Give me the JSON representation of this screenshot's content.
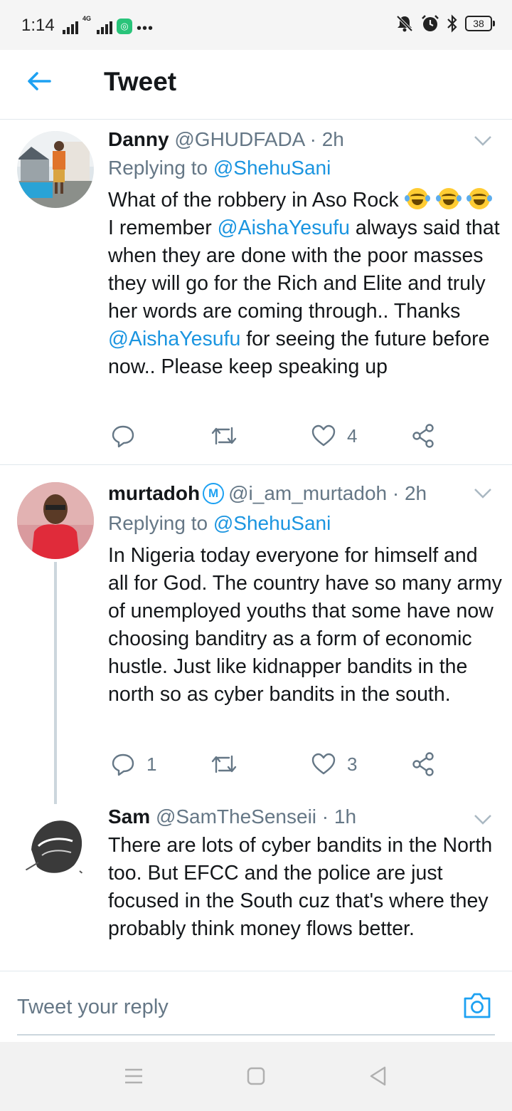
{
  "status_bar": {
    "time": "1:14",
    "network": "4G",
    "more": "•••",
    "battery": "38",
    "icons": [
      "signal-icon",
      "signal-4g-icon",
      "app-notification-icon",
      "mute-icon",
      "alarm-icon",
      "bluetooth-icon",
      "battery-icon"
    ]
  },
  "header": {
    "title": "Tweet",
    "back_icon": "arrow-left-icon"
  },
  "tweets": [
    {
      "name": "Danny",
      "handle": "@GHUDFADA",
      "time": "· 2h",
      "replying_label": "Replying to",
      "replying_to": "@ShehuSani",
      "body": {
        "p1": "What of the robbery in Aso Rock",
        "p2": " I remember ",
        "mention1": "@AishaYesufu",
        "p3": " always said that when they are done with the poor masses they will go for the Rich and Elite and truly her words are coming through.. Thanks ",
        "mention2": "@AishaYesufu",
        "p4": " for seeing the future before now.. Please keep speaking up"
      },
      "reply_count": "",
      "retweet_count": "",
      "like_count": "4"
    },
    {
      "name": "murtadoh",
      "verified_glyph": "M",
      "handle": "@i_am_murtadoh",
      "time": "· 2h",
      "replying_label": "Replying to",
      "replying_to": "@ShehuSani",
      "body": "In Nigeria today everyone for himself and all for God. The country have so many army of unemployed youths that some have now choosing banditry as a form of economic hustle. Just like kidnapper bandits in the north so as cyber bandits in the south.",
      "reply_count": "1",
      "retweet_count": "",
      "like_count": "3"
    },
    {
      "name": "Sam",
      "handle": "@SamTheSenseii",
      "time": "· 1h",
      "body": "There are lots of cyber bandits in the North too. But EFCC and the police are just focused in the South cuz that's where they probably think money flows better."
    }
  ],
  "reply_bar": {
    "placeholder": "Tweet your reply",
    "camera_icon": "camera-icon"
  },
  "nav_bar": {
    "icons": [
      "menu-icon",
      "home-square-icon",
      "back-triangle-icon"
    ]
  },
  "colors": {
    "accent": "#1da1f2",
    "link": "#1b95e0",
    "text": "#14171a",
    "muted": "#657786",
    "divider": "#e1e8ed"
  }
}
